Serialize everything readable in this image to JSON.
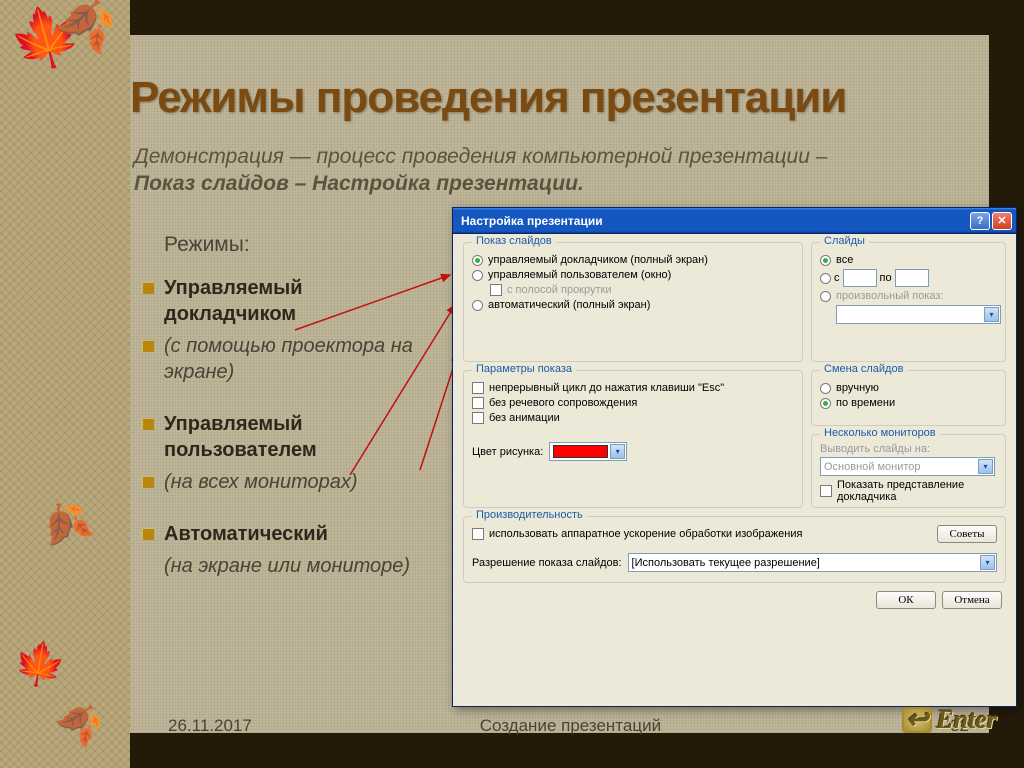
{
  "title": "Режимы проведения презентации",
  "subtitle_plain": "Демонстрация — процесс проведения компьютерной презентации – ",
  "subtitle_bold": "Показ слайдов – Настройка презентации.",
  "modes_label": "Режимы:",
  "bullets": {
    "b1": "Управляемый докладчиком",
    "b2": " (с помощью проектора на экране)",
    "b3": "Управляемый пользователем",
    "b4": "(на всех мониторах)",
    "b5": "Автоматический",
    "b6": "(на экране или мониторе)"
  },
  "dialog": {
    "title": "Настройка презентации",
    "g_show": "Показ слайдов",
    "r_presenter": "управляемый докладчиком (полный экран)",
    "r_user": "управляемый пользователем (окно)",
    "c_scroll": "с полосой прокрутки",
    "r_auto": "автоматический (полный экран)",
    "g_slides": "Слайды",
    "r_all": "все",
    "r_from": "с",
    "lbl_to": "по",
    "r_custom": "произвольный показ:",
    "g_params": "Параметры показа",
    "c_loop": "непрерывный цикл до нажатия клавиши \"Esc\"",
    "c_nospeech": "без речевого сопровождения",
    "c_noanim": "без анимации",
    "lbl_color": "Цвет рисунка:",
    "g_advance": "Смена слайдов",
    "r_manual": "вручную",
    "r_time": "по времени",
    "g_mon": "Несколько мониторов",
    "lbl_monout": "Выводить слайды на:",
    "sel_mon": "Основной монитор",
    "c_presview": "Показать представление докладчика",
    "g_perf": "Производительность",
    "c_hw": "использовать аппаратное ускорение обработки изображения",
    "lbl_res": "Разрешение показа слайдов:",
    "sel_res": "[Использовать текущее разрешение]",
    "btn_tips": "Советы",
    "btn_ok": "ОК",
    "btn_cancel": "Отмена"
  },
  "footer": {
    "date": "26.11.2017",
    "center": "Создание презентаций",
    "page": "32"
  },
  "enter": "Enter"
}
